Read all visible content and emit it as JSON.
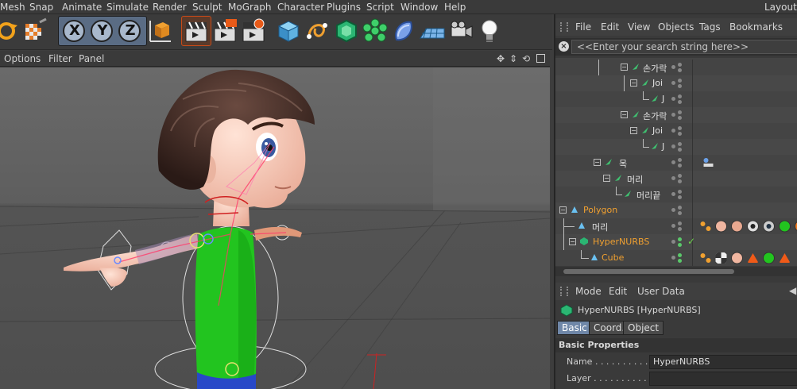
{
  "menubar": {
    "items": [
      "Mesh",
      "Snap",
      "Animate",
      "Simulate",
      "Render",
      "Sculpt",
      "MoGraph",
      "Character",
      "Plugins",
      "Script",
      "Window",
      "Help"
    ],
    "layout_label": "Layout:"
  },
  "toolbar": {
    "axis_x": "X",
    "axis_y": "Y",
    "axis_z": "Z"
  },
  "viewport_header": {
    "items": [
      "Options",
      "Filter",
      "Panel"
    ]
  },
  "object_manager": {
    "menu": [
      "File",
      "Edit",
      "View",
      "Objects",
      "Tags",
      "Bookmarks"
    ],
    "search_placeholder": "<<Enter your search string here>>",
    "rows": [
      {
        "name": "손가락"
      },
      {
        "name": "Joi"
      },
      {
        "name": "J"
      },
      {
        "name": "손가락"
      },
      {
        "name": "Joi"
      },
      {
        "name": "J"
      },
      {
        "name": "목"
      },
      {
        "name": "머리"
      },
      {
        "name": "머리끝"
      },
      {
        "name": "Polygon"
      },
      {
        "name": "머리"
      },
      {
        "name": "HyperNURBS"
      },
      {
        "name": "Cube"
      }
    ]
  },
  "attribute_manager": {
    "menu": [
      "Mode",
      "Edit",
      "User Data"
    ],
    "title": "HyperNURBS [HyperNURBS]",
    "tabs": [
      "Basic",
      "Coord.",
      "Object"
    ],
    "section": "Basic Properties",
    "fields": [
      {
        "label": "Name . . . . . . . . . . . .",
        "value": "HyperNURBS"
      },
      {
        "label": "Layer . . . . . . . . . . . .",
        "value": ""
      }
    ]
  },
  "colors": {
    "accent_orange": "#f0a030",
    "shirt_green": "#22c41f",
    "active_tab": "#6f87a8"
  }
}
